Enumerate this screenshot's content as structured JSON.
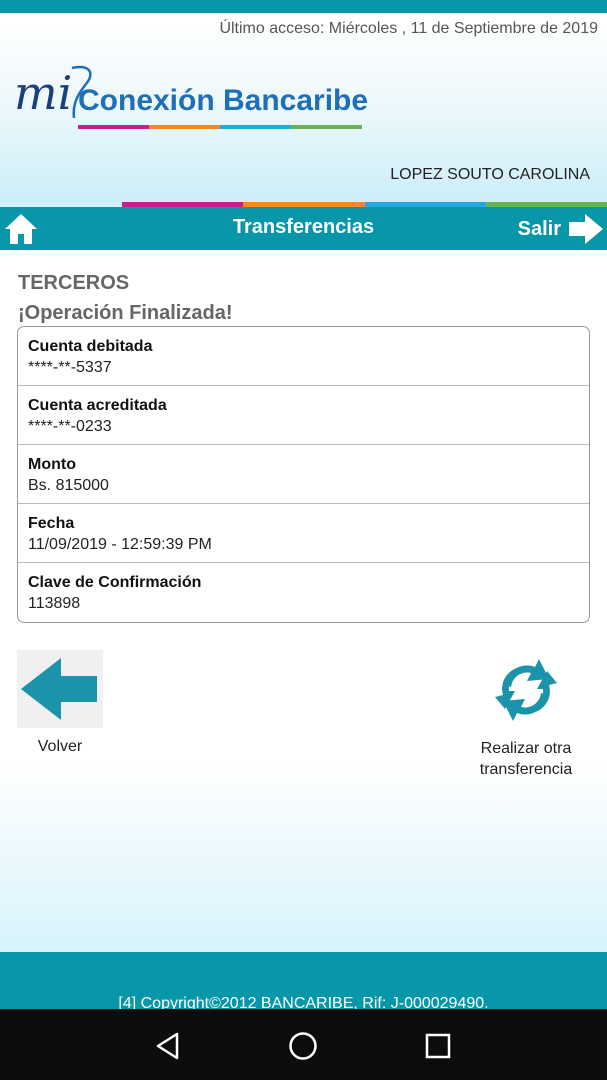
{
  "header": {
    "last_access": "Último acceso: Miércoles , 11 de Septiembre de 2019",
    "logo": {
      "prefix": "mi",
      "name": "Conexión Bancaribe"
    },
    "user_name": "LOPEZ SOUTO CAROLINA"
  },
  "colors": {
    "primary_teal": "#0797a8",
    "stripe_blue": "#1d6fb8",
    "stripe_magenta": "#c71d8f",
    "stripe_orange": "#f08a24",
    "stripe_cyan": "#22a9df",
    "stripe_green": "#6ab450"
  },
  "navbar": {
    "home_icon": "home-icon",
    "title": "Transferencias",
    "logout_label": "Salir",
    "logout_icon": "arrow-right-icon"
  },
  "content": {
    "section_title": "TERCEROS",
    "status": "¡Operación Finalizada!",
    "details": [
      {
        "label": "Cuenta debitada",
        "value": "****-**-5337"
      },
      {
        "label": "Cuenta acreditada",
        "value": "****-**-0233"
      },
      {
        "label": "Monto",
        "value": "Bs. 815000"
      },
      {
        "label": "Fecha",
        "value": "11/09/2019 - 12:59:39 PM"
      },
      {
        "label": "Clave de Confirmación",
        "value": "113898"
      }
    ]
  },
  "actions": {
    "back": {
      "label": "Volver",
      "icon": "arrow-left-icon"
    },
    "again": {
      "label": "Realizar otra transferencia",
      "icon": "refresh-icon"
    }
  },
  "footer": {
    "copyright": "[4] Copyright©2012 BANCARIBE, Rif: J-000029490."
  },
  "system_nav": {
    "back_icon": "back-triangle-icon",
    "home_icon": "home-circle-icon",
    "recents_icon": "recents-square-icon"
  }
}
